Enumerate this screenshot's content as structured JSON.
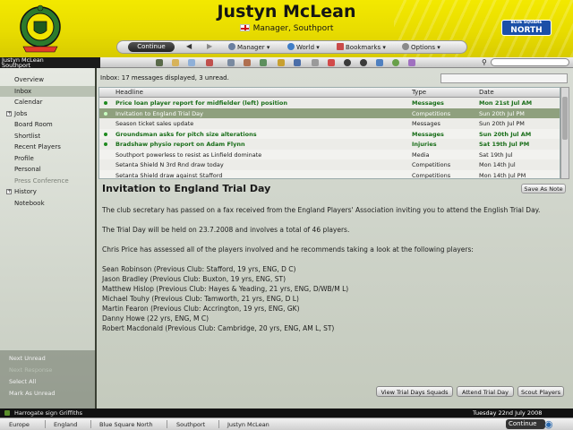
{
  "header": {
    "manager_name": "Justyn McLean",
    "role": "Manager, Southport",
    "league_badge_top": "BLUE SQUARE",
    "league_badge_bottom": "NORTH",
    "club_crest": "southport-crest",
    "colors": {
      "header_yellow": "#f0e400",
      "selected_row": "#8fa07e",
      "unread_green": "#186d18"
    }
  },
  "nav": {
    "continue": "Continue",
    "manager": "Manager",
    "world": "World",
    "bookmarks": "Bookmarks",
    "options": "Options"
  },
  "club_bar": {
    "line1": "Justyn McLean",
    "line2": "Southport"
  },
  "sidebar": {
    "items": [
      {
        "label": "Overview"
      },
      {
        "label": "Inbox"
      },
      {
        "label": "Calendar"
      },
      {
        "label": "Jobs"
      },
      {
        "label": "Board Room"
      },
      {
        "label": "Shortlist"
      },
      {
        "label": "Recent Players"
      },
      {
        "label": "Profile"
      },
      {
        "label": "Personal"
      },
      {
        "label": "Press Conference"
      },
      {
        "label": "History"
      },
      {
        "label": "Notebook"
      }
    ],
    "actions": [
      {
        "label": "Next Unread"
      },
      {
        "label": "Next Response"
      },
      {
        "label": "Select All"
      },
      {
        "label": "Mark As Unread"
      }
    ]
  },
  "inbox": {
    "status": "Inbox: 17 messages displayed, 3 unread.",
    "columns": [
      "Headline",
      "Type",
      "Date"
    ],
    "rows": [
      {
        "headline": "Price loan player report for midfielder (left) position",
        "type": "Messages",
        "date": "Mon 21st Jul AM"
      },
      {
        "headline": "Invitation to England Trial Day",
        "type": "Competitions",
        "date": "Sun 20th Jul PM"
      },
      {
        "headline": "Season ticket sales update",
        "type": "Messages",
        "date": "Sun 20th Jul PM"
      },
      {
        "headline": "Groundsman asks for pitch size alterations",
        "type": "Messages",
        "date": "Sun 20th Jul AM"
      },
      {
        "headline": "Bradshaw physio report on Adam Flynn",
        "type": "Injuries",
        "date": "Sat 19th Jul PM"
      },
      {
        "headline": "Southport powerless to resist as Linfield dominate",
        "type": "Media",
        "date": "Sat 19th Jul"
      },
      {
        "headline": "Setanta Shield N 3rd Rnd draw today",
        "type": "Competitions",
        "date": "Mon 14th Jul"
      },
      {
        "headline": "Setanta Shield draw against Stafford",
        "type": "Competitions",
        "date": "Mon 14th Jul PM"
      }
    ]
  },
  "message": {
    "title": "Invitation to England Trial Day",
    "save_note": "Save As Note",
    "p1": "The club secretary has passed on a fax received from the England Players' Association inviting you to attend the English Trial Day.",
    "p2": "The Trial Day will be held on 23.7.2008 and involves a total of 46 players.",
    "p3": "Chris Price has assessed all of the players involved and he recommends taking a look at the following players:",
    "players": [
      "Sean Robinson (Previous Club: Stafford, 19 yrs, ENG, D C)",
      "Jason Bradley (Previous Club: Buxton, 19 yrs, ENG, ST)",
      "Matthew Hislop (Previous Club: Hayes & Yeading, 21 yrs, ENG, D/WB/M L)",
      "Michael Touhy (Previous Club: Tamworth, 21 yrs, ENG, D L)",
      "Martin Fearon (Previous Club: Accrington, 19 yrs, ENG, GK)",
      "Danny Howe (22 yrs, ENG, M C)",
      "Robert Macdonald (Previous Club: Cambridge, 20 yrs, ENG, AM L, ST)"
    ],
    "buttons": {
      "view_squads": "View Trial Days Squads",
      "attend": "Attend Trial Day",
      "scout": "Scout Players"
    }
  },
  "footer": {
    "news": "Harrogate sign Griffiths",
    "date": "Tuesday 22nd July 2008",
    "crumbs": [
      "Europe",
      "England",
      "Blue Square North",
      "Southport",
      "Justyn McLean"
    ],
    "continue": "Continue"
  }
}
